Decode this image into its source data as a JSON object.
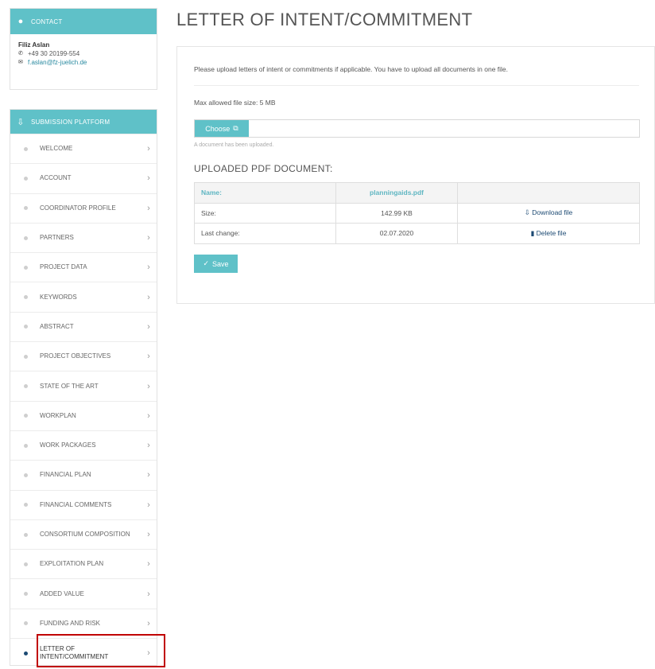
{
  "contact": {
    "header": "CONTACT",
    "name": "Filiz Aslan",
    "phone": "+49 30 20199-554",
    "email": "f.aslan@fz-juelich.de"
  },
  "nav": {
    "header": "SUBMISSION PLATFORM",
    "items": [
      {
        "label": "WELCOME"
      },
      {
        "label": "ACCOUNT"
      },
      {
        "label": "COORDINATOR PROFILE"
      },
      {
        "label": "PARTNERS"
      },
      {
        "label": "PROJECT DATA"
      },
      {
        "label": "KEYWORDS"
      },
      {
        "label": "ABSTRACT"
      },
      {
        "label": "PROJECT OBJECTIVES"
      },
      {
        "label": "STATE OF THE ART"
      },
      {
        "label": "WORKPLAN"
      },
      {
        "label": "WORK PACKAGES"
      },
      {
        "label": "FINANCIAL PLAN"
      },
      {
        "label": "FINANCIAL COMMENTS"
      },
      {
        "label": "CONSORTIUM COMPOSITION"
      },
      {
        "label": "EXPLOITATION PLAN"
      },
      {
        "label": "ADDED VALUE"
      },
      {
        "label": "FUNDING AND RISK"
      },
      {
        "label": "LETTER OF INTENT/COMMITMENT",
        "active": true
      }
    ]
  },
  "main": {
    "title": "LETTER OF INTENT/COMMITMENT",
    "intro": "Please upload letters of intent or commitments if applicable. You have to upload all documents in one file.",
    "max_size": "Max allowed file size: 5 MB",
    "choose_label": "Choose",
    "uploaded_note": "A document has been uploaded.",
    "section_title": "UPLOADED PDF DOCUMENT:",
    "table": {
      "name_label": "Name:",
      "name_value": "planningaids.pdf",
      "size_label": "Size:",
      "size_value": "142.99 KB",
      "download_label": "Download file",
      "change_label": "Last change:",
      "change_value": "02.07.2020",
      "delete_label": "Delete file"
    },
    "save_label": "Save"
  },
  "colors": {
    "accent": "#5fc1c8",
    "active_dot": "#1c4a73",
    "highlight": "#c00000"
  }
}
